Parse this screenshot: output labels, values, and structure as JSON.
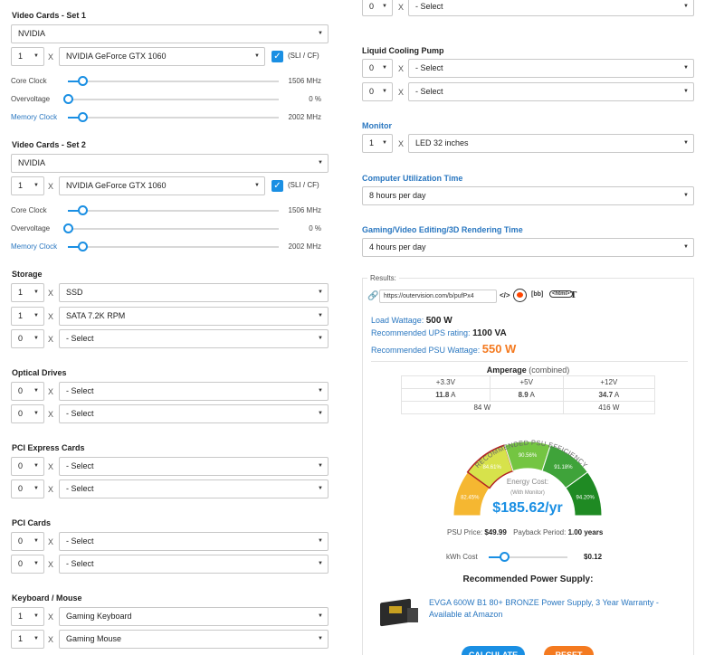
{
  "video_set1": {
    "title": "Video Cards - Set 1",
    "brand": "NVIDIA",
    "qty": "1",
    "model": "NVIDIA GeForce GTX 1060",
    "sli_label": "(SLI / CF)",
    "sliders": [
      {
        "label": "Core Clock",
        "value": "1506 MHz",
        "level": 0.03
      },
      {
        "label": "Overvoltage",
        "value": "0 %",
        "level": 0.0
      },
      {
        "label": "Memory Clock",
        "value": "2002 MHz",
        "level": 0.03
      }
    ]
  },
  "video_set2": {
    "title": "Video Cards - Set 2",
    "brand": "NVIDIA",
    "qty": "1",
    "model": "NVIDIA GeForce GTX 1060",
    "sli_label": "(SLI / CF)",
    "sliders": [
      {
        "label": "Core Clock",
        "value": "1506 MHz",
        "level": 0.03
      },
      {
        "label": "Overvoltage",
        "value": "0 %",
        "level": 0.0
      },
      {
        "label": "Memory Clock",
        "value": "2002 MHz",
        "level": 0.03
      }
    ]
  },
  "x": "X",
  "storage": {
    "title": "Storage",
    "rows": [
      {
        "qty": "1",
        "item": "SSD"
      },
      {
        "qty": "1",
        "item": "SATA 7.2K RPM"
      },
      {
        "qty": "0",
        "item": "- Select"
      }
    ]
  },
  "optical": {
    "title": "Optical Drives",
    "rows": [
      {
        "qty": "0",
        "item": "- Select"
      },
      {
        "qty": "0",
        "item": "- Select"
      }
    ]
  },
  "pci_express": {
    "title": "PCI Express Cards",
    "rows": [
      {
        "qty": "0",
        "item": "- Select"
      },
      {
        "qty": "0",
        "item": "- Select"
      }
    ]
  },
  "pci": {
    "title": "PCI Cards",
    "rows": [
      {
        "qty": "0",
        "item": "- Select"
      },
      {
        "qty": "0",
        "item": "- Select"
      }
    ]
  },
  "keyboard": {
    "title": "Keyboard / Mouse",
    "rows": [
      {
        "qty": "1",
        "item": "Gaming Keyboard"
      },
      {
        "qty": "1",
        "item": "Gaming Mouse"
      }
    ]
  },
  "top_right_row": {
    "qty": "0",
    "item": "- Select"
  },
  "pump": {
    "title": "Liquid Cooling Pump",
    "rows": [
      {
        "qty": "0",
        "item": "- Select"
      },
      {
        "qty": "0",
        "item": "- Select"
      }
    ]
  },
  "monitor": {
    "title": "Monitor",
    "qty": "1",
    "item": "LED 32 inches"
  },
  "utilization": {
    "title": "Computer Utilization Time",
    "value": "8 hours per day"
  },
  "gaming": {
    "title": "Gaming/Video Editing/3D Rendering Time",
    "value": "4 hours per day"
  },
  "results": {
    "legend": "Results:",
    "url": "https://outervision.com/b/pufPx4",
    "share_bb": "[bb]",
    "share_html": "<html>",
    "share_t": "T",
    "load_label": "Load Wattage:",
    "load_value": "500 W",
    "ups_label": "Recommended UPS rating:",
    "ups_value": "1100 VA",
    "psu_label": "Recommended PSU Wattage:",
    "psu_value": "550 W",
    "amperage_title": "Amperage",
    "amperage_sub": "(combined)",
    "rails": [
      "+3.3V",
      "+5V",
      "+12V"
    ],
    "amps": [
      "11.8",
      "8.9",
      "34.7"
    ],
    "amp_unit": "A",
    "watts_combined": "84 W",
    "watts_12v": "416 W",
    "gauge_title": "RECOMMENDED PSU EFFICIENCY",
    "gauge_segments": [
      "82.45%",
      "84.61%",
      "90.56%",
      "91.18%",
      "94.20%"
    ],
    "energy_label": "Energy Cost:",
    "energy_sub": "(With Monitor)",
    "energy_value": "$185.62/yr",
    "psu_price_label": "PSU Price:",
    "psu_price": "$49.99",
    "payback_label": "Payback Period:",
    "payback": "1.00 years",
    "kwh_label": "kWh Cost",
    "kwh_value": "$0.12",
    "kwh_level": 0.2,
    "rec_title": "Recommended Power Supply:",
    "rec_link": "EVGA 600W B1 80+ BRONZE Power Supply, 3 Year Warranty - Available at Amazon",
    "calc_button": "CALCULATE",
    "reset_button": "RESET"
  },
  "colors": {
    "accent": "#1a8fe3",
    "link": "#2a77c0",
    "psu_orange": "#f47a20",
    "gauge": [
      "#f5b731",
      "#d7e24b",
      "#74c542",
      "#3fa33a",
      "#1f8a23"
    ]
  }
}
